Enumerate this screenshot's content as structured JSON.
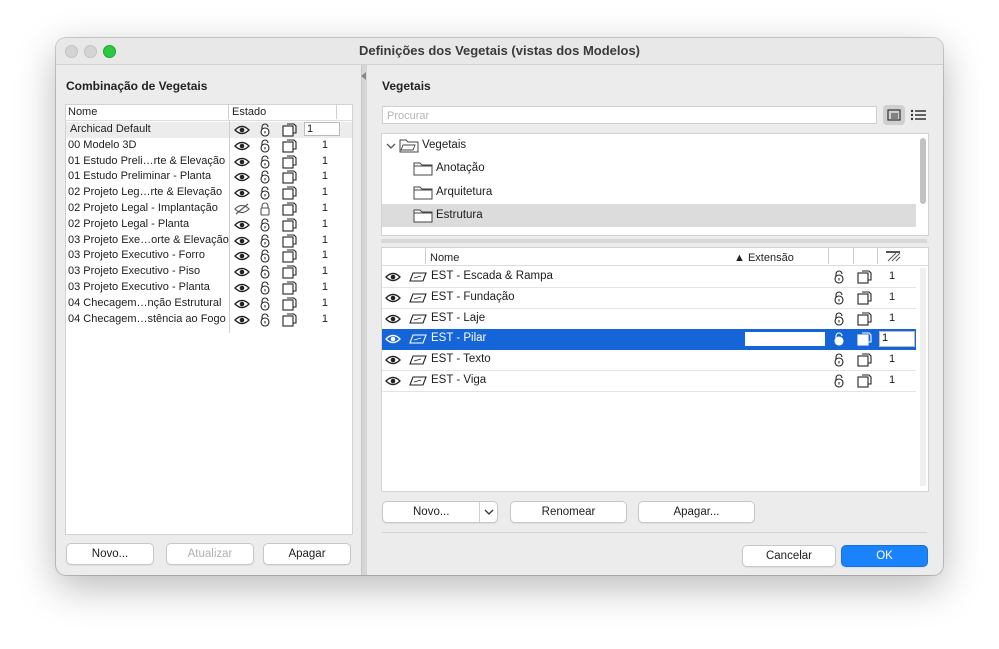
{
  "window": {
    "title": "Definições dos Vegetais (vistas dos Modelos)"
  },
  "left": {
    "heading": "Combinação de Vegetais",
    "col_name": "Nome",
    "col_state": "Estado",
    "rows": [
      {
        "name": "Archicad Default",
        "value": "1",
        "selected": true
      },
      {
        "name": "00 Modelo 3D",
        "value": "1"
      },
      {
        "name": "01 Estudo Preli…rte & Elevação",
        "value": "1"
      },
      {
        "name": "01 Estudo Preliminar - Planta",
        "value": "1"
      },
      {
        "name": "02 Projeto Leg…rte & Elevação",
        "value": "1"
      },
      {
        "name": "02 Projeto Legal - Implantação",
        "value": "1",
        "hidden": true
      },
      {
        "name": "02 Projeto Legal - Planta",
        "value": "1"
      },
      {
        "name": "03 Projeto Exe…orte & Elevação",
        "value": "1"
      },
      {
        "name": "03 Projeto Executivo - Forro",
        "value": "1"
      },
      {
        "name": "03 Projeto Executivo - Piso",
        "value": "1"
      },
      {
        "name": "03 Projeto Executivo - Planta",
        "value": "1"
      },
      {
        "name": "04 Checagem…nção Estrutural",
        "value": "1"
      },
      {
        "name": "04 Checagem…stência ao Fogo",
        "value": "1"
      }
    ],
    "btn_new": "Novo...",
    "btn_update": "Atualizar",
    "btn_delete": "Apagar"
  },
  "right": {
    "heading": "Vegetais",
    "search_placeholder": "Procurar",
    "tree": {
      "root": "Vegetais",
      "folders": [
        "Anotação",
        "Arquitetura",
        "Estrutura"
      ],
      "selected_folder": "Estrutura"
    },
    "col_name": "Nome",
    "col_ext": "▲ Extensão",
    "rows": [
      {
        "name": "EST - Escada & Rampa",
        "value": "1"
      },
      {
        "name": "EST - Fundação",
        "value": "1"
      },
      {
        "name": "EST - Laje",
        "value": "1"
      },
      {
        "name": "EST - Pilar",
        "value": "1",
        "selected": true
      },
      {
        "name": "EST - Texto",
        "value": "1"
      },
      {
        "name": "EST - Viga",
        "value": "1"
      }
    ],
    "btn_new": "Novo...",
    "btn_rename": "Renomear",
    "btn_delete": "Apagar..."
  },
  "footer": {
    "cancel": "Cancelar",
    "ok": "OK"
  },
  "colors": {
    "accent": "#1a82fb",
    "selection": "#1665d8"
  }
}
